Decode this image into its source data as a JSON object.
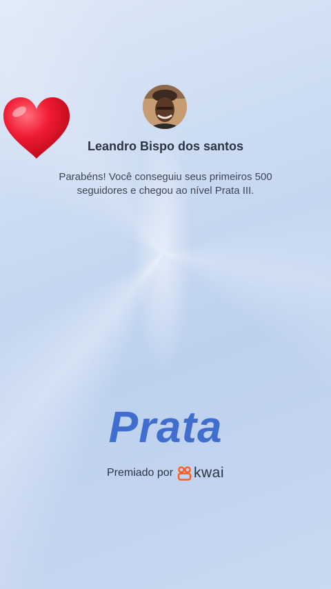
{
  "profile": {
    "user_name": "Leandro Bispo dos santos",
    "avatar_icon": "user-avatar-photo"
  },
  "message": {
    "text": "Parabéns! Você conseguiu seus primeiros 500 seguidores e chegou ao nível Prata III."
  },
  "decoration": {
    "heart_icon": "red-heart-emoji",
    "heart_color": "#e0122b"
  },
  "level": {
    "title": "Prata",
    "color": "#3f6ecf"
  },
  "footer": {
    "awarded_label": "Premiado por",
    "brand_name": "kwai",
    "brand_icon": "kwai-logo-icon",
    "brand_color": "#ff5c1a"
  }
}
